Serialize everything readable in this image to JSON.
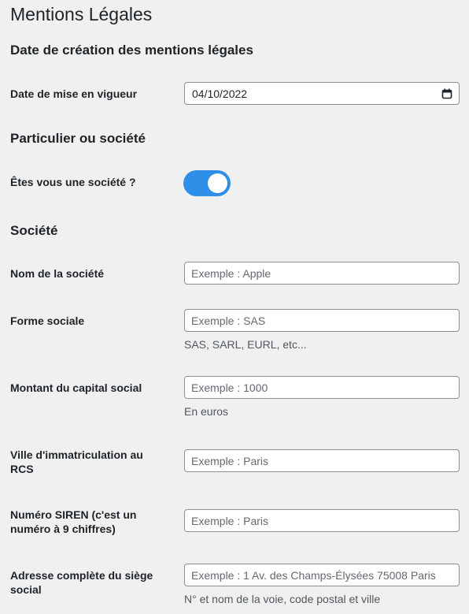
{
  "page": {
    "title": "Mentions Légales"
  },
  "sections": {
    "date": {
      "title": "Date de création des mentions légales"
    },
    "type": {
      "title": "Particulier ou société"
    },
    "company": {
      "title": "Société"
    }
  },
  "fields": {
    "effective_date": {
      "label": "Date de mise en vigueur",
      "value": "04/10/2022"
    },
    "is_company": {
      "label": "Êtes vous une société ?",
      "checked": true,
      "accent": "#2e8fe8"
    },
    "company_name": {
      "label": "Nom de la société",
      "placeholder": "Exemple : Apple"
    },
    "legal_form": {
      "label": "Forme sociale",
      "placeholder": "Exemple : SAS",
      "hint": "SAS, SARL, EURL, etc..."
    },
    "capital": {
      "label": "Montant du capital social",
      "placeholder": "Exemple : 1000",
      "hint": "En euros"
    },
    "rcs_city": {
      "label": "Ville d'immatriculation au RCS",
      "placeholder": "Exemple : Paris"
    },
    "siren": {
      "label": "Numéro SIREN (c'est un numéro à 9 chiffres)",
      "placeholder": "Exemple : Paris"
    },
    "address": {
      "label": "Adresse complète du siège social",
      "placeholder": "Exemple : 1 Av. des Champs-Élysées 75008 Paris",
      "hint": "N° et nom de la voie, code postal et ville"
    }
  },
  "icons": {
    "date_picker": "calendar-icon"
  }
}
